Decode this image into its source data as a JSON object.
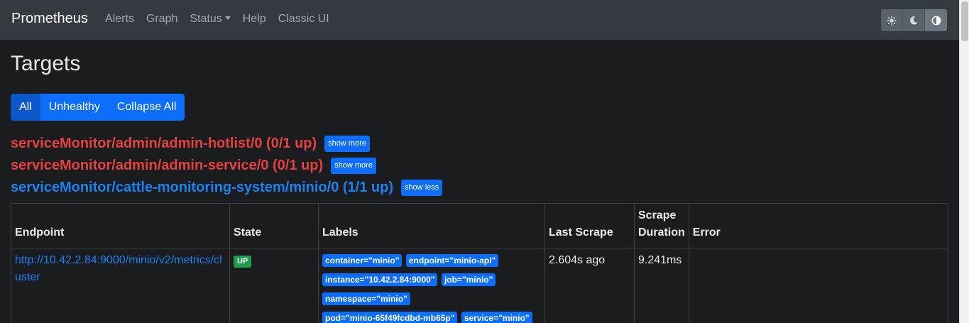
{
  "navbar": {
    "brand": "Prometheus",
    "links": [
      "Alerts",
      "Graph",
      "Status",
      "Help",
      "Classic UI"
    ],
    "theme_buttons": [
      "sun-icon",
      "moon-icon",
      "contrast-icon"
    ]
  },
  "page": {
    "title": "Targets"
  },
  "filters": {
    "all": "All",
    "unhealthy": "Unhealthy",
    "collapse": "Collapse All"
  },
  "pools": [
    {
      "title": "serviceMonitor/admin/admin-hotlist/0 (0/1 up)",
      "toggle": "show more",
      "status": "bad"
    },
    {
      "title": "serviceMonitor/admin/admin-service/0 (0/1 up)",
      "toggle": "show more",
      "status": "bad"
    },
    {
      "title": "serviceMonitor/cattle-monitoring-system/minio/0 (1/1 up)",
      "toggle": "show less",
      "status": "good"
    }
  ],
  "table": {
    "headers": {
      "endpoint": "Endpoint",
      "state": "State",
      "labels": "Labels",
      "last_scrape": "Last Scrape",
      "scrape_duration_1": "Scrape",
      "scrape_duration_2": "Duration",
      "error": "Error"
    },
    "rows": [
      {
        "endpoint": "http://10.42.2.84:9000/minio/v2/metrics/cluster",
        "state": "UP",
        "labels": [
          "container=\"minio\"",
          "endpoint=\"minio-api\"",
          "instance=\"10.42.2.84:9000\"",
          "job=\"minio\"",
          "namespace=\"minio\"",
          "pod=\"minio-65f49fcdbd-mb65p\"",
          "service=\"minio\""
        ],
        "last_scrape": "2.604s ago",
        "scrape_duration": "9.241ms",
        "error": ""
      }
    ]
  },
  "colors": {
    "navbar_bg": "#343a40",
    "page_bg": "#1b1c1f",
    "unhealthy": "#e5413f",
    "healthy": "#1b82ef",
    "primary": "#0d6efd",
    "up_badge": "#1e9e4a"
  }
}
